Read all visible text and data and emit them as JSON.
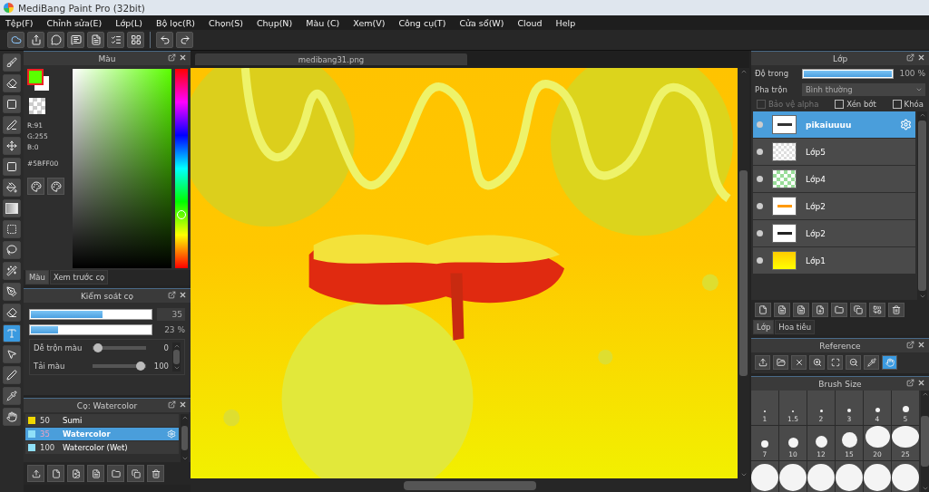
{
  "window": {
    "title": "MediBang Paint Pro (32bit)"
  },
  "menu": [
    "Tệp(F)",
    "Chỉnh sửa(E)",
    "Lớp(L)",
    "Bộ lọc(R)",
    "Chọn(S)",
    "Chụp(N)",
    "Màu (C)",
    "Xem(V)",
    "Công cụ(T)",
    "Cửa sổ(W)",
    "Cloud",
    "Help"
  ],
  "toolbar": [
    {
      "kind": "cloud"
    },
    {
      "kind": "share"
    },
    {
      "kind": "bubble"
    },
    {
      "kind": "comment"
    },
    {
      "kind": "page"
    },
    {
      "kind": "list"
    },
    {
      "kind": "grid"
    },
    {
      "kind": "undo"
    },
    {
      "kind": "redo"
    }
  ],
  "tools": [
    {
      "kind": "brush",
      "selected": false
    },
    {
      "kind": "eraser",
      "selected": false
    },
    {
      "kind": "dot",
      "selected": false
    },
    {
      "kind": "pen",
      "selected": false
    },
    {
      "kind": "move",
      "selected": false
    },
    {
      "kind": "fill-square",
      "selected": false
    },
    {
      "kind": "bucket",
      "selected": false
    },
    {
      "kind": "gradient",
      "selected": false
    },
    {
      "kind": "select",
      "selected": false
    },
    {
      "kind": "lasso",
      "selected": false
    },
    {
      "kind": "wand",
      "selected": false
    },
    {
      "kind": "select-pen",
      "selected": false
    },
    {
      "kind": "select-eraser",
      "selected": false
    },
    {
      "kind": "text",
      "selected": true
    },
    {
      "kind": "pointer",
      "selected": false
    },
    {
      "kind": "marker",
      "selected": false
    },
    {
      "kind": "dropper",
      "selected": false
    },
    {
      "kind": "hand",
      "selected": false
    }
  ],
  "color_panel": {
    "title": "Màu",
    "readings": [
      "R:91",
      "G:255",
      "B:0"
    ],
    "hex": "#5BFF00",
    "hue": {
      "level": 0.27
    },
    "tabs": [
      {
        "label": "Màu",
        "selected": true
      },
      {
        "label": "Xem trước cọ",
        "selected": false
      }
    ]
  },
  "brush_control": {
    "title": "Kiểm soát cọ",
    "size": {
      "level": 0.6,
      "reading": "35"
    },
    "opacity": {
      "level": 0.23,
      "reading": "23 %"
    },
    "options": [
      {
        "label": "Dễ trộn màu",
        "level": 0,
        "reading": "0"
      },
      {
        "label": "Tải màu",
        "level": 1,
        "reading": "100"
      }
    ]
  },
  "brush_list": {
    "title": "Cọ: Watercolor",
    "items": [
      {
        "size": "50",
        "name": "Sumi",
        "color": "#f0d800",
        "selected": false
      },
      {
        "size": "35",
        "name": "Watercolor",
        "color": "#8fe0f8",
        "selected": true
      },
      {
        "size": "100",
        "name": "Watercolor (Wet)",
        "color": "#8fe0f8",
        "selected": false
      }
    ]
  },
  "document": {
    "tab": "medibang31.png"
  },
  "layer_panel": {
    "title": "Lớp",
    "opacity": {
      "label": "Độ trong",
      "level": 1,
      "reading": "100 %"
    },
    "blend": {
      "label": "Pha trộn",
      "value": "Bình thường"
    },
    "options": [
      {
        "label": "Bảo vệ alpha",
        "checked": false,
        "disabled": true
      },
      {
        "label": "Xén bớt",
        "checked": false,
        "disabled": false
      },
      {
        "label": "Khóa",
        "checked": false,
        "disabled": false
      }
    ],
    "layers": [
      {
        "name": "pikaiuuuu",
        "kind": "text",
        "selected": true
      },
      {
        "name": "Lớp5",
        "kind": "blank",
        "selected": false
      },
      {
        "name": "Lớp4",
        "kind": "green",
        "selected": false
      },
      {
        "name": "Lớp2",
        "kind": "orange",
        "selected": false
      },
      {
        "name": "Lớp2",
        "kind": "dark",
        "selected": false
      },
      {
        "name": "Lớp1",
        "kind": "gradient",
        "selected": false
      }
    ],
    "tabs": [
      {
        "label": "Lớp",
        "selected": true
      },
      {
        "label": "Hoa tiêu",
        "selected": false
      }
    ]
  },
  "reference": {
    "title": "Reference"
  },
  "brush_size": {
    "title": "Brush Size",
    "sizes": [
      "1",
      "1.5",
      "2",
      "3",
      "4",
      "5",
      "7",
      "10",
      "12",
      "15",
      "20",
      "25"
    ]
  }
}
